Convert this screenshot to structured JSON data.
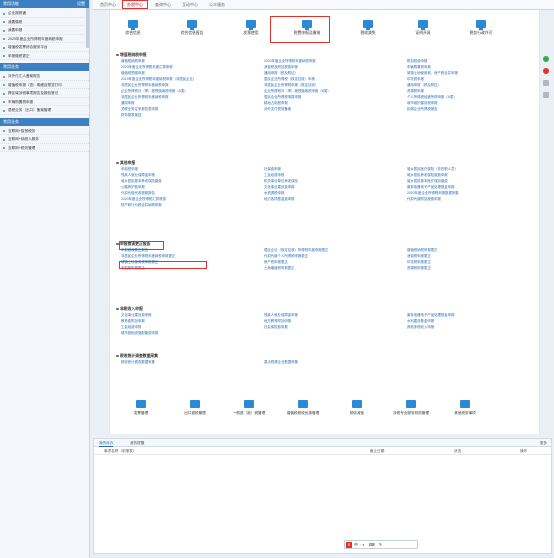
{
  "sidebar": {
    "group1": {
      "title": "常用功能",
      "right": "设置"
    },
    "group1_items": [
      "企业报税通",
      "我要缴税",
      "我要申报",
      "2020年度企业所得税年度纳税申报",
      "增值税发票综合服务平台",
      "申报缴税更正"
    ],
    "group2": {
      "title": "常用业务"
    },
    "group2_items": [
      "对外付汇人备案报告",
      "增值税申报（查）明细及预览打印",
      "跨区域涉税事项报告及报验登记",
      "车辆购置税申报",
      "退税业务（出口）备案管理"
    ],
    "group3": {
      "title": "常用业务"
    },
    "group3_items": [
      "互联网+智慧税务",
      "互联网+纳税人服务",
      "互联网+税务管理"
    ]
  },
  "topbar": {
    "tabs": [
      "首页中心",
      "办税中心",
      "查询中心",
      "互动中心",
      "公众服务"
    ],
    "active_index": 1
  },
  "categories": [
    "综合信息",
    "综合信息报告",
    "发票使用",
    "税费申报及缴纳",
    "税收减免",
    "证明开具",
    "税务行政许可"
  ],
  "sections": [
    {
      "title": "增值税纳税申报",
      "links": [
        "增值税纳税申报",
        "2020年度企业所得税年度纳税申报",
        "附加税费申报",
        "2020年度企业所得税年度汇算申报",
        "消费税及附加税费申报",
        "车辆购置税申报",
        "增值税预缴申报",
        "通用申报（税及附征）",
        "城镇土地使用税、房产税合并申报",
        "2019年度企业所得税年度纳税申报（非居民企业）",
        "居民企业所得税（核定征收）申报",
        "印花税申报",
        "非居民企业所得税年度纳税申报",
        "非居民企业所得税申报（核定征收）",
        "通用申报（税及附征）",
        "企业所得税月（季）度预缴纳税申报（A类）",
        "企业所得税月（季）度预缴纳税申报（B类）",
        "资源税申报",
        "非居民企业所得税年度纳税申报",
        "居民企业所得税清算申报",
        "个人所得税经营所得申报（A表）",
        "通用申报",
        "耕地占用税申报",
        "城市维护建设税申报",
        "关联业务往来报告表申报",
        "对外支付税务备案",
        "扣缴企业所得税报告",
        "财务报表报送"
      ]
    },
    {
      "title": "其他申报",
      "links": [
        "车船税申报",
        "社保费申报",
        "城乡居民医疗保险（非在职人员）",
        "残疾人就业保障金申报",
        "工会经费申报",
        "城乡居民养老保险缴费申报",
        "城乡居民基本养老保险缴费",
        "机关事业单位养老保险",
        "城乡居民基本医疗保险缴费",
        "公路养护费申报",
        "文化事业建设费申报",
        "废弃电器电子产品处理基金申报",
        "代扣代缴代收税款报告",
        "水资源税申报",
        "2020年度企业所得税申报数据采集",
        "2020年度企业所得税汇算清缴",
        "地方各项基金费申报",
        "代扣代缴附加税费申报",
        "财产和行为税合并纳税申报"
      ]
    },
    {
      "title": "申报错误更正报告",
      "links": [
        "申报错误更正报告",
        "居民企业（核定征收）所得税年度申报更正",
        "增值税纳税申报更正",
        "非居民企业所得税年度纳税申报更正",
        "代扣代缴个人所得税申报更正",
        "消费税申报更正",
        "城镇土地使用税申报更正",
        "房产税申报更正",
        "印花税申报更正",
        "车船税申报更正",
        "土地增值税申报更正",
        "资源税申报更正"
      ]
    },
    {
      "title": "非税收入申报",
      "links": [
        "文化事业建设费申报",
        "残疾人就业保障金申报",
        "废弃电器电子产品处理基金申报",
        "教育费附加申报",
        "地方教育附加申报",
        "水利建设基金申报",
        "工会经费申报",
        "社会保险费申报",
        "其他非税收入申报",
        "城市基础设施配套费申报"
      ]
    },
    {
      "title": "税收统计调查数据采集",
      "links": [
        "税收统计调查数据采集",
        "重点税源企业数据采集"
      ]
    }
  ],
  "bottom_icons": [
    "发票管理",
    "出口退税管理",
    "一般退（抵）税管理",
    "增值税税收优惠管理",
    "税收减免",
    "涉税专业服务机构管理",
    "其他税务事项"
  ],
  "pending": {
    "tabs": [
      "我的待办",
      "我的提醒"
    ],
    "more": "更多",
    "columns": [
      "事项名称（申报表）",
      "截止日期",
      "状态",
      "操作"
    ]
  },
  "ime": {
    "logo": "S",
    "label": "中·◐ ⌨ ✎"
  },
  "colors": {
    "accent": "#2b8ad6",
    "highlight": "#e0332e",
    "sidebar_head": "#3d7fc0"
  }
}
